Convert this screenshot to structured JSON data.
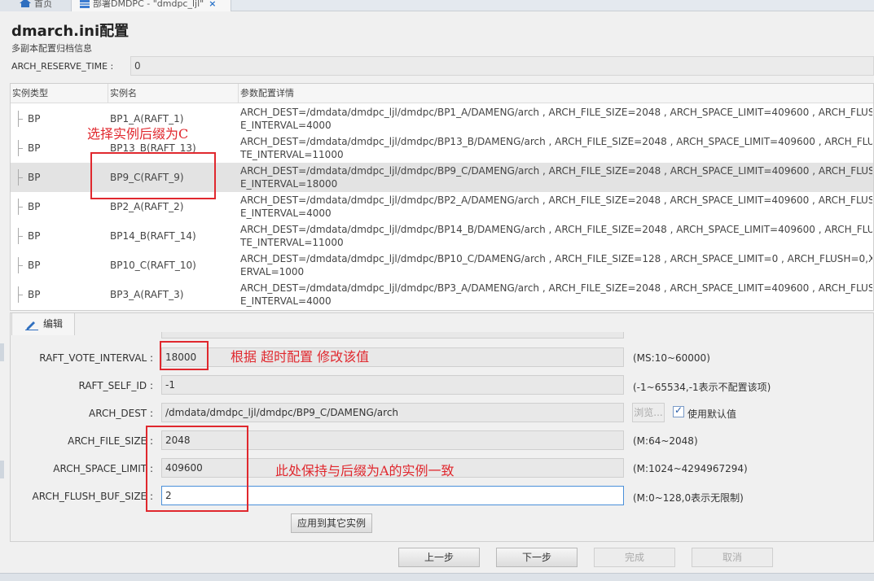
{
  "tabs": {
    "home_label": "首页",
    "deploy_label": "部署DMDPC - \"dmdpc_ljl\"",
    "close_glyph": "×"
  },
  "page": {
    "title": "dmarch.ini配置",
    "subtitle": "多副本配置归档信息",
    "reserve_label": "ARCH_RESERVE_TIME :",
    "reserve_value": "0"
  },
  "table": {
    "headers": [
      "实例类型",
      "实例名",
      "参数配置详情"
    ],
    "rows": [
      {
        "type": "BP",
        "name": "BP1_A(RAFT_1)",
        "detail1": "ARCH_DEST=/dmdata/dmdpc_ljl/dmdpc/BP1_A/DAMENG/arch , ARCH_FILE_SIZE=2048 , ARCH_SPACE_LIMIT=409600 , ARCH_FLUSH=2,",
        "detail2": "E_INTERVAL=4000"
      },
      {
        "type": "BP",
        "name": "BP13_B(RAFT_13)",
        "detail1": "ARCH_DEST=/dmdata/dmdpc_ljl/dmdpc/BP13_B/DAMENG/arch , ARCH_FILE_SIZE=2048 , ARCH_SPACE_LIMIT=409600 , ARCH_FLUSH=",
        "detail2": "TE_INTERVAL=11000"
      },
      {
        "type": "BP",
        "name": "BP9_C(RAFT_9)",
        "detail1": "ARCH_DEST=/dmdata/dmdpc_ljl/dmdpc/BP9_C/DAMENG/arch , ARCH_FILE_SIZE=2048 , ARCH_SPACE_LIMIT=409600 , ARCH_FLUSH=0,",
        "detail2": "E_INTERVAL=18000"
      },
      {
        "type": "BP",
        "name": "BP2_A(RAFT_2)",
        "detail1": "ARCH_DEST=/dmdata/dmdpc_ljl/dmdpc/BP2_A/DAMENG/arch , ARCH_FILE_SIZE=2048 , ARCH_SPACE_LIMIT=409600 , ARCH_FLUSH=2,",
        "detail2": "E_INTERVAL=4000"
      },
      {
        "type": "BP",
        "name": "BP14_B(RAFT_14)",
        "detail1": "ARCH_DEST=/dmdata/dmdpc_ljl/dmdpc/BP14_B/DAMENG/arch , ARCH_FILE_SIZE=2048 , ARCH_SPACE_LIMIT=409600 , ARCH_FLUSH=",
        "detail2": "TE_INTERVAL=11000"
      },
      {
        "type": "BP",
        "name": "BP10_C(RAFT_10)",
        "detail1": "ARCH_DEST=/dmdata/dmdpc_ljl/dmdpc/BP10_C/DAMENG/arch , ARCH_FILE_SIZE=128 , ARCH_SPACE_LIMIT=0 , ARCH_FLUSH=0,XMAL",
        "detail2": "ERVAL=1000"
      },
      {
        "type": "BP",
        "name": "BP3_A(RAFT_3)",
        "detail1": "ARCH_DEST=/dmdata/dmdpc_ljl/dmdpc/BP3_A/DAMENG/arch , ARCH_FILE_SIZE=2048 , ARCH_SPACE_LIMIT=409600 , ARCH_FLUSH=2,",
        "detail2": "E_INTERVAL=4000"
      }
    ]
  },
  "editor": {
    "tab_label": "编辑",
    "fields": {
      "vote_interval": {
        "label": "RAFT_VOTE_INTERVAL :",
        "value": "18000",
        "hint": "(MS:10~60000)"
      },
      "self_id": {
        "label": "RAFT_SELF_ID :",
        "value": "-1",
        "hint": "(-1~65534,-1表示不配置该项)"
      },
      "arch_dest": {
        "label": "ARCH_DEST :",
        "value": "/dmdata/dmdpc_ljl/dmdpc/BP9_C/DAMENG/arch"
      },
      "file_size": {
        "label": "ARCH_FILE_SIZE :",
        "value": "2048",
        "hint": "(M:64~2048)"
      },
      "space_limit": {
        "label": "ARCH_SPACE_LIMIT :",
        "value": "409600",
        "hint": "(M:1024~4294967294)"
      },
      "flush_buf": {
        "label": "ARCH_FLUSH_BUF_SIZE :",
        "value": "2",
        "hint": "(M:0~128,0表示无限制)"
      }
    },
    "browse_label": "浏览...",
    "default_label": "使用默认值",
    "apply_label": "应用到其它实例"
  },
  "nav": {
    "prev": "上一步",
    "next": "下一步",
    "finish": "完成",
    "cancel": "取消"
  },
  "annotations": {
    "select_c": "选择实例后缀为C",
    "timeout": "根据  超时配置  修改该值",
    "keep_same": "此处保持与后缀为A的实例一致"
  },
  "colors": {
    "annotation": "#e0282e",
    "selected_row": "#e3e3e3",
    "active_border": "#4a90d9"
  }
}
